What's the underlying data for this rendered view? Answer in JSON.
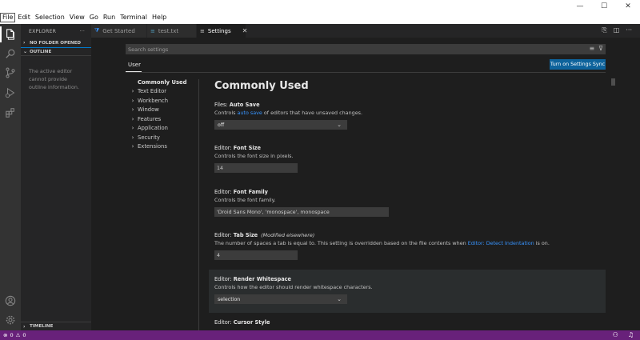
{
  "menu": [
    "File",
    "Edit",
    "Selection",
    "View",
    "Go",
    "Run",
    "Terminal",
    "Help"
  ],
  "window_controls": {
    "minimize": "—",
    "maximize": "☐",
    "close": "✕"
  },
  "sidebar": {
    "title": "EXPLORER",
    "more": "···",
    "sections": {
      "no_folder": "NO FOLDER OPENED",
      "outline": "OUTLINE",
      "timeline": "TIMELINE"
    },
    "outline_message": "The active editor cannot provide outline information."
  },
  "tabs": [
    {
      "label": "Get Started",
      "icon": "vscode-logo-icon",
      "active": false
    },
    {
      "label": "test.txt",
      "icon": "text-file-icon",
      "active": false
    },
    {
      "label": "Settings",
      "icon": "settings-file-icon",
      "active": true,
      "close": "✕"
    }
  ],
  "settings": {
    "search_placeholder": "Search settings",
    "scope_tab": "User",
    "sync_button": "Turn on Settings Sync",
    "toc": {
      "active": "Commonly Used",
      "items": [
        "Text Editor",
        "Workbench",
        "Window",
        "Features",
        "Application",
        "Security",
        "Extensions"
      ]
    },
    "heading": "Commonly Used",
    "items": {
      "auto_save": {
        "category": "Files: ",
        "name": "Auto Save",
        "desc_before": "Controls ",
        "desc_link": "auto save",
        "desc_after": " of editors that have unsaved changes.",
        "value": "off"
      },
      "font_size": {
        "category": "Editor: ",
        "name": "Font Size",
        "desc": "Controls the font size in pixels.",
        "value": "14"
      },
      "font_family": {
        "category": "Editor: ",
        "name": "Font Family",
        "desc": "Controls the font family.",
        "value": "'Droid Sans Mono', 'monospace', monospace"
      },
      "tab_size": {
        "category": "Editor: ",
        "name": "Tab Size",
        "modified": "(Modified elsewhere)",
        "desc_before": "The number of spaces a tab is equal to. This setting is overridden based on the file contents when ",
        "desc_link": "Editor: Detect Indentation",
        "desc_after": " is on.",
        "value": "4"
      },
      "render_whitespace": {
        "category": "Editor: ",
        "name": "Render Whitespace",
        "desc": "Controls how the editor should render whitespace characters.",
        "value": "selection"
      },
      "cursor_style": {
        "category": "Editor: ",
        "name": "Cursor Style"
      }
    }
  },
  "statusbar": {
    "errors": "0",
    "warnings": "0"
  }
}
